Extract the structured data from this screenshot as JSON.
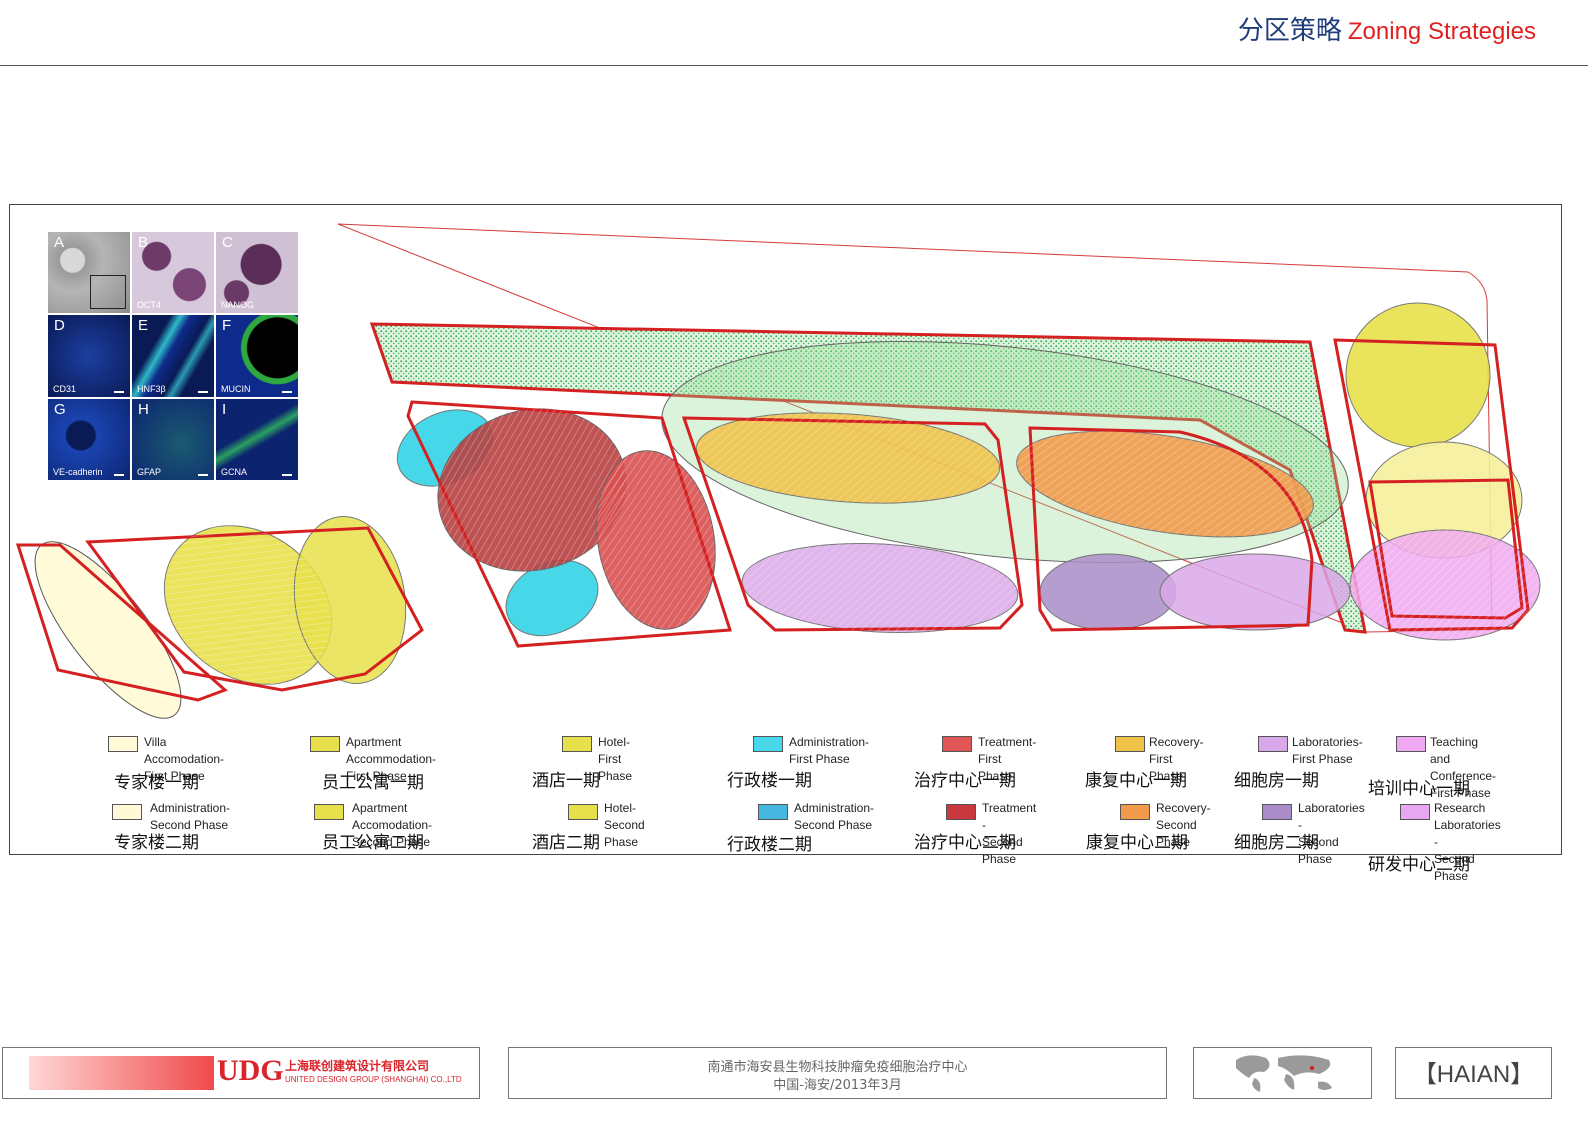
{
  "header": {
    "title_cn": "分区策略",
    "title_en": "Zoning  Strategies"
  },
  "inset": {
    "panels": [
      {
        "letter": "A",
        "caption": ""
      },
      {
        "letter": "B",
        "caption": "OCT4"
      },
      {
        "letter": "C",
        "caption": "NANOG"
      },
      {
        "letter": "D",
        "caption": "CD31"
      },
      {
        "letter": "E",
        "caption": "HNF3β"
      },
      {
        "letter": "F",
        "caption": "MUCIN"
      },
      {
        "letter": "G",
        "caption": "VE-cadherin"
      },
      {
        "letter": "H",
        "caption": "GFAP"
      },
      {
        "letter": "I",
        "caption": "GCNA"
      }
    ]
  },
  "legend": [
    {
      "en": "Villa Accomodation-\nFirst Phase",
      "cn": "专家楼一期",
      "color": "#fff9d6"
    },
    {
      "en": "Apartment Accommodation-\nFirst Phase",
      "cn": "员工公寓一期",
      "color": "#e8e04a"
    },
    {
      "en": "Hotel- First Phase",
      "cn": "酒店一期",
      "color": "#e8e04a"
    },
    {
      "en": "Administration-\nFirst Phase",
      "cn": "行政楼一期",
      "color": "#46d8e8"
    },
    {
      "en": "Treatment-\nFirst Phase",
      "cn": "治疗中心一期",
      "color": "#e05555"
    },
    {
      "en": "Recovery- First\nPhase",
      "cn": "康复中心一期",
      "color": "#f0c24a"
    },
    {
      "en": "Laboratories-\nFirst Phase",
      "cn": "细胞房一期",
      "color": "#d9a8e8"
    },
    {
      "en": "Teaching and\nConference-\nFirst Phase",
      "cn": "培训中心一期",
      "color": "#f0a8f0"
    },
    {
      "en": "Administration-\nSecond Phase",
      "cn": "专家楼二期",
      "color": "#fff9d6"
    },
    {
      "en": "Apartment Accomodation-\nSecond Phase",
      "cn": "员工公寓二期",
      "color": "#e8e04a"
    },
    {
      "en": "Hotel- Second\nPhase",
      "cn": "酒店二期",
      "color": "#e8e04a"
    },
    {
      "en": "Administration-\nSecond Phase",
      "cn": "行政楼二期",
      "color": "#46b8e0"
    },
    {
      "en": "Treatment -\nSecond Phase",
      "cn": "治疗中心二期",
      "color": "#c8383c"
    },
    {
      "en": "Recovery-\nSecond Phase",
      "cn": "康复中心二期",
      "color": "#f09a4a"
    },
    {
      "en": "Laboratories -\nSecond Phase",
      "cn": "细胞房二期",
      "color": "#a98cc8"
    },
    {
      "en": "Research\nLaboratories -\nSecond Phase",
      "cn": "研发中心二期",
      "color": "#e8a8f0"
    }
  ],
  "footer": {
    "logo_mark": "UDG",
    "company_cn": "上海联创建筑设计有限公司",
    "company_en": "UNITED DESIGN GROUP (SHANGHAI) CO.,LTD",
    "project_line1": "南通市海安县生物科技肿瘤免疫细胞治疗中心",
    "project_line2": "中国-海安/2013年3月",
    "city_tag": "【HAIAN】"
  }
}
